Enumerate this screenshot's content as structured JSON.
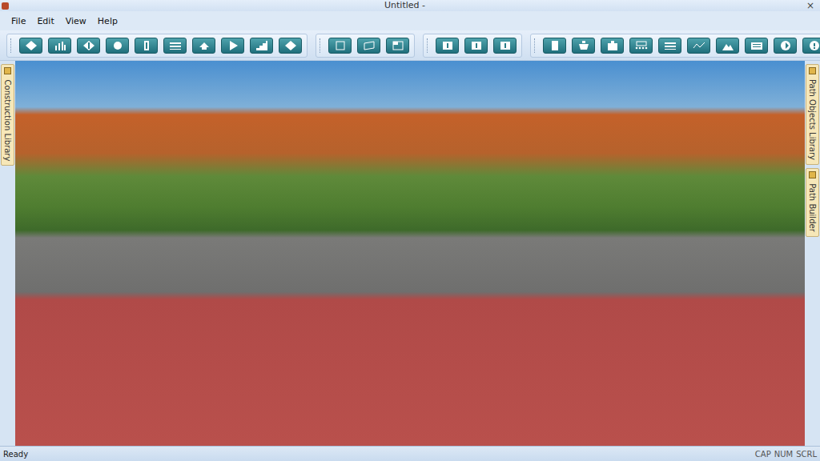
{
  "window": {
    "title": "Untitled -",
    "close": "×"
  },
  "menu": [
    "File",
    "Edit",
    "View",
    "Help"
  ],
  "left_panel": {
    "tabs": [
      {
        "label": "Construction Library"
      }
    ]
  },
  "right_panel": {
    "tabs": [
      {
        "label": "Path Objects Library"
      },
      {
        "label": "Path Builder"
      }
    ]
  },
  "status_bar": {
    "text": "Ready",
    "indicators": [
      "CAP",
      "NUM",
      "SCRL"
    ]
  }
}
